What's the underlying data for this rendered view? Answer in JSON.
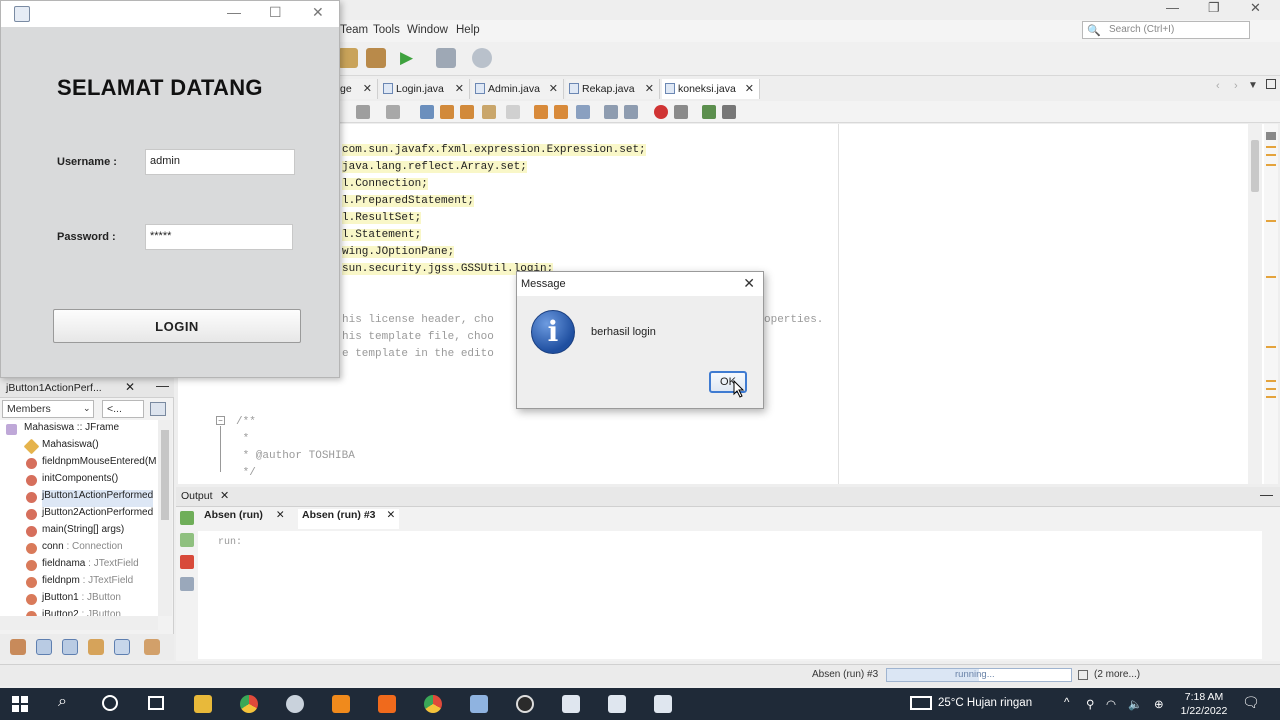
{
  "ide": {
    "menu": [
      "Team",
      "Tools",
      "Window",
      "Help"
    ],
    "search_placeholder": "Search (Ctrl+I)",
    "tabs": [
      {
        "label": "ge"
      },
      {
        "label": "Login.java"
      },
      {
        "label": "Admin.java"
      },
      {
        "label": "Rekap.java"
      },
      {
        "label": "koneksi.java"
      }
    ],
    "code_lines": [
      "com.sun.javafx.fxml.expression.Expression.set;",
      "java.lang.reflect.Array.set;",
      "l.Connection;",
      "l.PreparedStatement;",
      "l.ResultSet;",
      "l.Statement;",
      "wing.JOptionPane;",
      "sun.security.jgss.GSSUtil.login;"
    ],
    "comment_lines": [
      "his license header, cho",
      "his template file, choo",
      "e template in the edito"
    ],
    "comment_tail": "operties.",
    "javadoc": [
      "/**",
      " *",
      " * @author TOSHIBA",
      " */"
    ]
  },
  "navigator": {
    "title": "jButton1ActionPerf...",
    "combo": "Members",
    "combo2": "<...",
    "root": "Mahasiswa :: JFrame",
    "items": [
      {
        "name": "Mahasiswa()",
        "type": ""
      },
      {
        "name": "fieldnpmMouseEntered(M",
        "type": ""
      },
      {
        "name": "initComponents()",
        "type": ""
      },
      {
        "name": "jButton1ActionPerformed",
        "type": ""
      },
      {
        "name": "jButton2ActionPerformed",
        "type": ""
      },
      {
        "name": "main(String[] args)",
        "type": ""
      },
      {
        "name": "conn",
        "type": " : Connection"
      },
      {
        "name": "fieldnama",
        "type": " : JTextField"
      },
      {
        "name": "fieldnpm",
        "type": " : JTextField"
      },
      {
        "name": "jButton1",
        "type": " : JButton"
      },
      {
        "name": "jButton2",
        "type": " : JButton"
      }
    ]
  },
  "output": {
    "title": "Output",
    "tabs": [
      {
        "label": "Absen (run)"
      },
      {
        "label": "Absen (run) #3"
      }
    ],
    "text": "run:"
  },
  "status": {
    "task": "Absen (run) #3",
    "progress_label": "running...",
    "progress_fraction": 0.5,
    "more": "(2 more...)"
  },
  "login": {
    "heading": "SELAMAT DATANG",
    "username_label": "Username :",
    "username_value": "admin",
    "password_label": "Password :",
    "password_value": "*****",
    "button": "LOGIN"
  },
  "message": {
    "title": "Message",
    "text": "berhasil login",
    "ok": "OK"
  },
  "taskbar": {
    "weather": "25°C  Hujan ringan",
    "time": "7:18 AM",
    "date": "1/22/2022"
  },
  "colors": {
    "accent": "#3f7bd1",
    "taskbar": "#1f2a38"
  }
}
